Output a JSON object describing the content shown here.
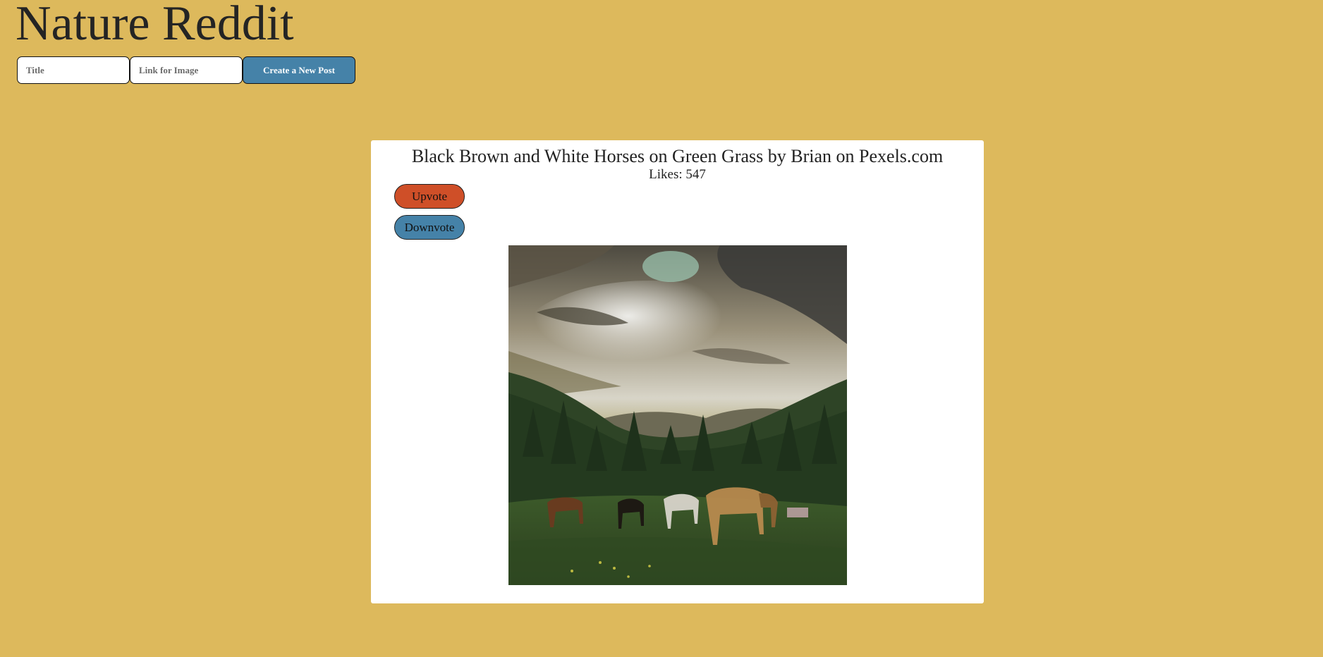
{
  "app": {
    "title": "Nature Reddit"
  },
  "form": {
    "title_placeholder": "Title",
    "image_link_placeholder": "Link for Image",
    "create_button_label": "Create a New Post"
  },
  "post": {
    "title": "Black Brown and White Horses on Green Grass by Brian on Pexels.com",
    "likes_text": "Likes: 547",
    "upvote_label": "Upvote",
    "downvote_label": "Downvote"
  },
  "colors": {
    "page_background": "#ddb95c",
    "card_background": "#ffffff",
    "upvote": "#cf4f28",
    "downvote_and_create": "#4582a8"
  }
}
